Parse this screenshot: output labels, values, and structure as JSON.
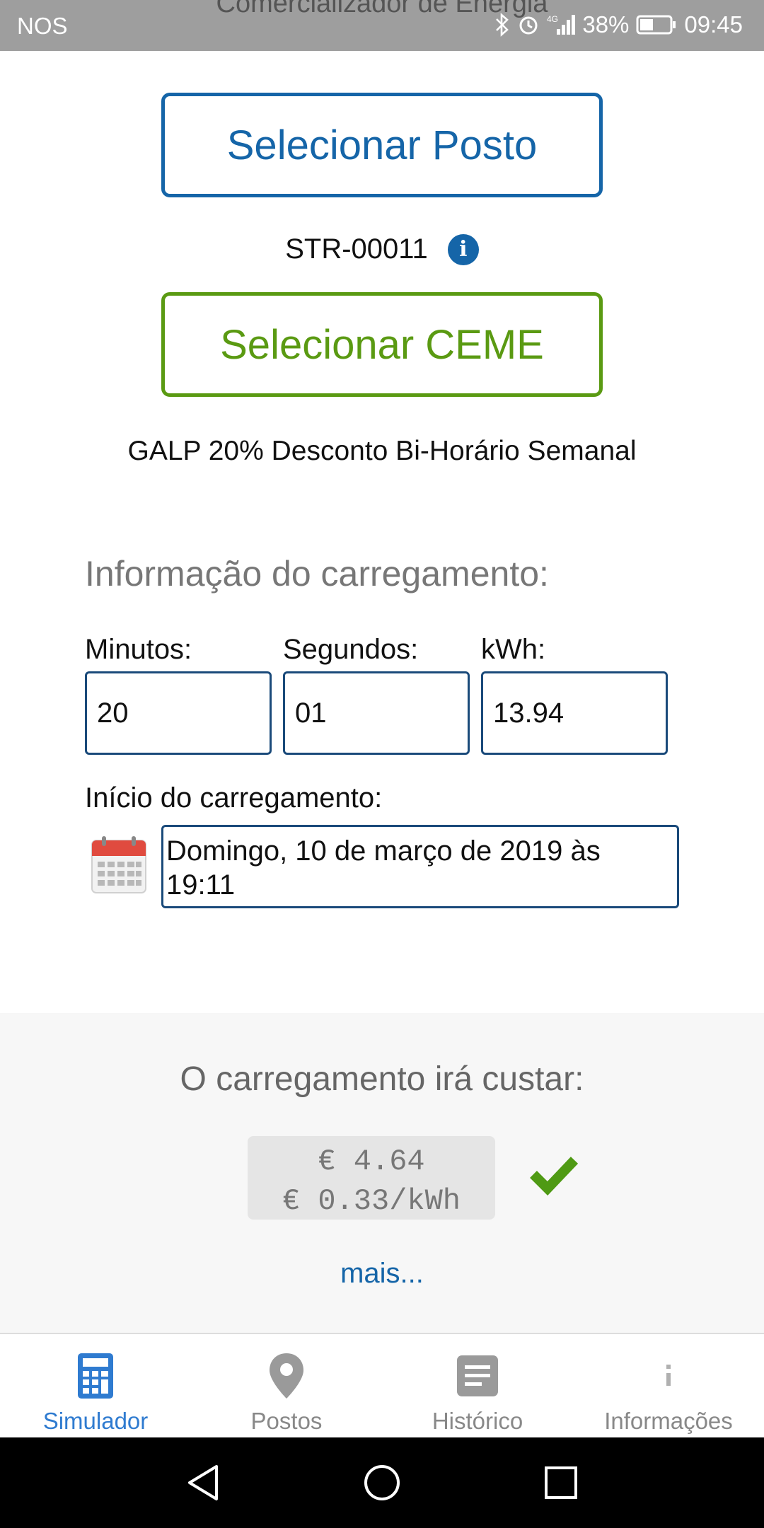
{
  "status_bar": {
    "carrier": "NOS",
    "behind_title": "Comercializador de Energia",
    "battery": "38%",
    "time": "09:45",
    "network": "4G"
  },
  "posto": {
    "button_label": "Selecionar Posto",
    "station_id": "STR-00011"
  },
  "ceme": {
    "button_label": "Selecionar CEME",
    "tariff_name": "GALP 20% Desconto Bi-Horário Semanal"
  },
  "charging": {
    "section_title": "Informação do carregamento:",
    "minutes_label": "Minutos:",
    "minutes_value": "20",
    "seconds_label": "Segundos:",
    "seconds_value": "01",
    "kwh_label": "kWh:",
    "kwh_value": "13.94",
    "start_label": "Início do carregamento:",
    "start_value": "Domingo, 10 de março de 2019 às 19:11"
  },
  "cost": {
    "title": "O carregamento irá custar:",
    "total": "€ 4.64",
    "per_kwh": "€ 0.33/kWh",
    "more_link": "mais..."
  },
  "bottom_nav": {
    "items": [
      {
        "label": "Simulador",
        "icon": "calculator-icon",
        "active": true
      },
      {
        "label": "Postos",
        "icon": "map-pin-icon",
        "active": false
      },
      {
        "label": "Histórico",
        "icon": "document-icon",
        "active": false
      },
      {
        "label": "Informações",
        "icon": "info-icon",
        "active": false
      }
    ]
  },
  "colors": {
    "primary_blue": "#1565a8",
    "green": "#5a9a12",
    "active_nav": "#2f7bd0",
    "inactive_nav": "#9a9a9a"
  }
}
